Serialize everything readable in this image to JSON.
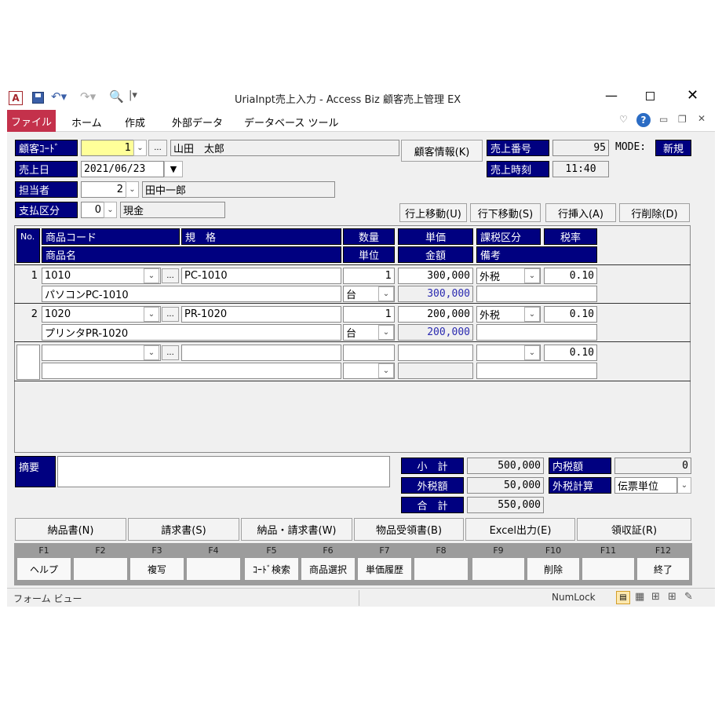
{
  "window": {
    "title": "UriaInpt売上入力 - Access Biz 顧客売上管理 EX",
    "app_icon": "A"
  },
  "ribbon": {
    "tabs": [
      "ファイル",
      "ホーム",
      "作成",
      "外部データ",
      "データベース ツール"
    ]
  },
  "header": {
    "customer_code_label": "顧客ｺｰﾄﾞ",
    "customer_code": "1",
    "customer_name": "山田　太郎",
    "customer_info_button": "顧客情報(K)",
    "sales_no_label": "売上番号",
    "sales_no": "95",
    "mode_label": "MODE:",
    "mode_value": "新規",
    "sales_date_label": "売上日",
    "sales_date": "2021/06/23",
    "sales_time_label": "売上時刻",
    "sales_time": "11:40",
    "staff_label": "担当者",
    "staff_code": "2",
    "staff_name": "田中一郎",
    "payment_label": "支払区分",
    "payment_code": "0",
    "payment_name": "現金"
  },
  "row_buttons": [
    "行上移動(U)",
    "行下移動(S)",
    "行挿入(A)",
    "行削除(D)"
  ],
  "grid": {
    "headers": {
      "no": "No.",
      "product_code": "商品コード",
      "spec": "規　格",
      "qty": "数量",
      "unit_price": "単価",
      "tax_type": "課税区分",
      "tax_rate": "税率",
      "product_name": "商品名",
      "unit": "単位",
      "amount": "金額",
      "note": "備考"
    },
    "rows": [
      {
        "no": "1",
        "code": "1010",
        "spec": "PC-1010",
        "qty": "1",
        "price": "300,000",
        "tax_type": "外税",
        "tax_rate": "0.10",
        "name": "パソコンPC-1010",
        "unit": "台",
        "amount": "300,000",
        "note": ""
      },
      {
        "no": "2",
        "code": "1020",
        "spec": "PR-1020",
        "qty": "1",
        "price": "200,000",
        "tax_type": "外税",
        "tax_rate": "0.10",
        "name": "プリンタPR-1020",
        "unit": "台",
        "amount": "200,000",
        "note": ""
      },
      {
        "no": "",
        "code": "",
        "spec": "",
        "qty": "",
        "price": "",
        "tax_type": "",
        "tax_rate": "0.10",
        "name": "",
        "unit": "",
        "amount": "",
        "note": ""
      }
    ]
  },
  "summary": {
    "memo_label": "摘要",
    "memo": "",
    "subtotal_label": "小　計",
    "subtotal": "500,000",
    "inner_tax_label": "内税額",
    "inner_tax": "0",
    "outer_tax_label": "外税額",
    "outer_tax": "50,000",
    "outer_tax_calc_label": "外税計算",
    "outer_tax_calc_value": "伝票単位",
    "total_label": "合　計",
    "total": "550,000"
  },
  "action_buttons": [
    "納品書(N)",
    "請求書(S)",
    "納品・請求書(W)",
    "物品受領書(B)",
    "Excel出力(E)",
    "領収証(R)"
  ],
  "fkeys": [
    {
      "key": "F1",
      "label": "ヘルプ"
    },
    {
      "key": "F2",
      "label": ""
    },
    {
      "key": "F3",
      "label": "複写"
    },
    {
      "key": "F4",
      "label": ""
    },
    {
      "key": "F5",
      "label": "ｺｰﾄﾞ検索"
    },
    {
      "key": "F6",
      "label": "商品選択"
    },
    {
      "key": "F7",
      "label": "単価履歴"
    },
    {
      "key": "F8",
      "label": ""
    },
    {
      "key": "F9",
      "label": ""
    },
    {
      "key": "F10",
      "label": "削除"
    },
    {
      "key": "F11",
      "label": ""
    },
    {
      "key": "F12",
      "label": "終了"
    }
  ],
  "statusbar": {
    "left": "フォーム ビュー",
    "numlock": "NumLock"
  },
  "colors": {
    "label_bg": "#000080",
    "file_tab": "#c4314b",
    "customer_code_bg": "#ffff99",
    "amount_text": "#2a2ab0"
  }
}
